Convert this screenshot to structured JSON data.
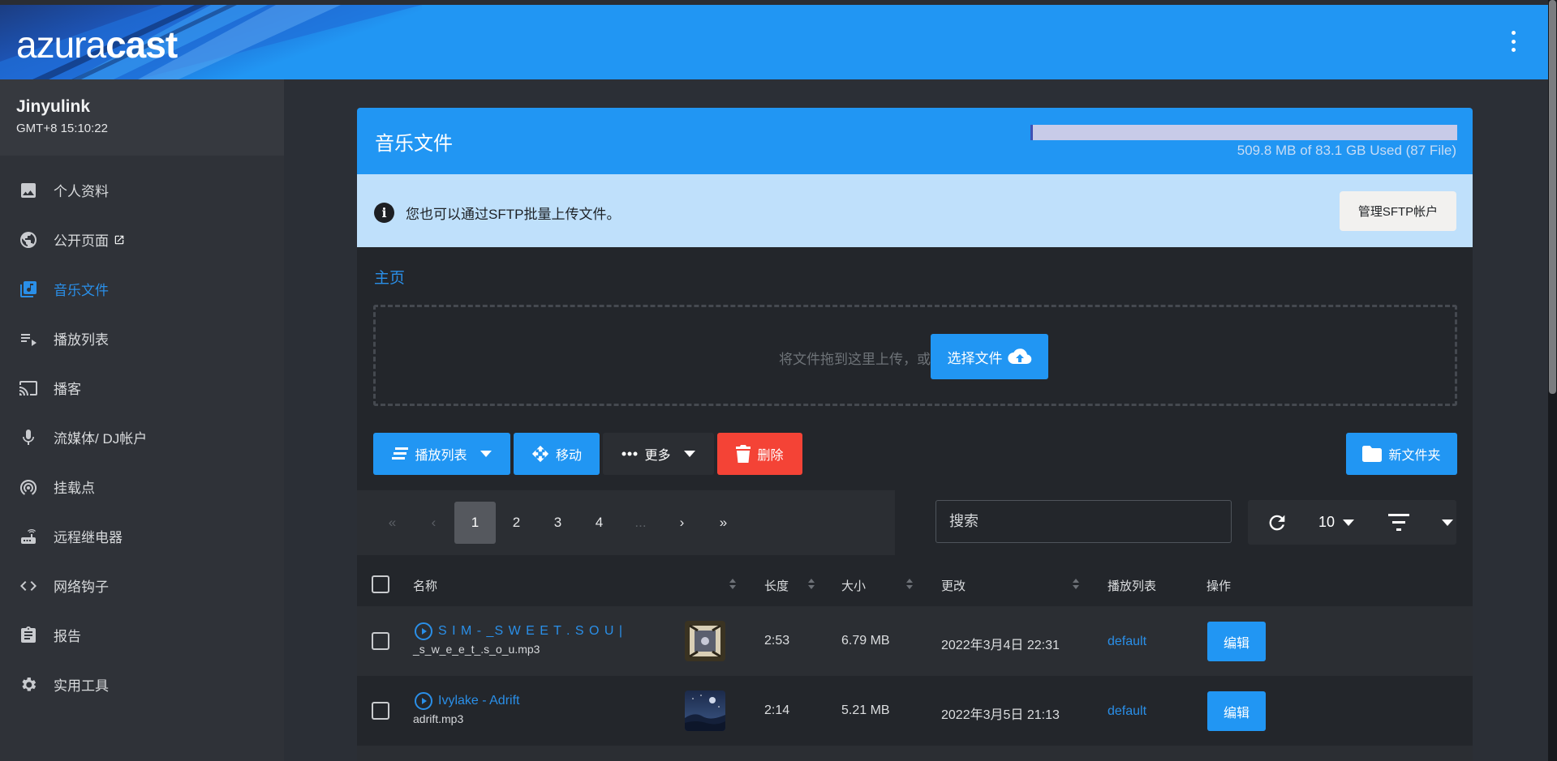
{
  "app": {
    "logo_light": "azura",
    "logo_bold": "cast",
    "menu_icon": "kebab-menu-icon"
  },
  "sidebar": {
    "station_name": "Jinyulink",
    "station_time": "GMT+8 15:10:22",
    "items": [
      {
        "label": "个人资料",
        "icon": "image-icon"
      },
      {
        "label": "公开页面",
        "icon": "globe-icon",
        "external_icon": "external-link-icon"
      },
      {
        "label": "音乐文件",
        "icon": "music-library-icon",
        "active": true
      },
      {
        "label": "播放列表",
        "icon": "playlist-icon"
      },
      {
        "label": "播客",
        "icon": "cast-icon"
      },
      {
        "label": "流媒体/ DJ帐户",
        "icon": "microphone-icon"
      },
      {
        "label": "挂载点",
        "icon": "podcast-broadcast-icon"
      },
      {
        "label": "远程继电器",
        "icon": "router-icon"
      },
      {
        "label": "网络钩子",
        "icon": "code-icon"
      },
      {
        "label": "报告",
        "icon": "clipboard-icon"
      },
      {
        "label": "实用工具",
        "icon": "settings-icon"
      }
    ]
  },
  "card": {
    "title": "音乐文件",
    "usage_text": "509.8 MB of 83.1 GB Used (87 File)",
    "usage_fraction": 0.006,
    "alert_text": "您也可以通过SFTP批量上传文件。",
    "sftp_button": "管理SFTP帐户",
    "breadcrumb": "主页",
    "drop_text": "将文件拖到这里上传，或",
    "pick_button": "选择文件"
  },
  "toolbar": {
    "playlist": "播放列表",
    "move": "移动",
    "more": "更多",
    "delete": "删除",
    "new_folder": "新文件夹"
  },
  "pager": {
    "first": "«",
    "prev": "‹",
    "pages": [
      "1",
      "2",
      "3",
      "4"
    ],
    "ellipsis": "...",
    "next": "›",
    "last": "»",
    "current": "1"
  },
  "search": {
    "placeholder": "搜索"
  },
  "per_page": "10",
  "table": {
    "headers": {
      "name": "名称",
      "length": "长度",
      "size": "大小",
      "modified": "更改",
      "playlists": "播放列表",
      "actions": "操作"
    },
    "rows": [
      {
        "title": "S I M - _S W E E T . S O U |",
        "file": "_s_w_e_e_t_.s_o_u.mp3",
        "length": "2:53",
        "size": "6.79 MB",
        "modified": "2022年3月4日 22:31",
        "playlist": "default",
        "edit": "编辑"
      },
      {
        "title": "Ivylake - Adrift",
        "file": "adrift.mp3",
        "length": "2:14",
        "size": "5.21 MB",
        "modified": "2022年3月5日 21:13",
        "playlist": "default",
        "edit": "编辑"
      }
    ]
  },
  "colors": {
    "accent": "#2196f3",
    "danger": "#f44336",
    "link": "#2a8fe8",
    "alert_bg": "#bfe0fb"
  }
}
